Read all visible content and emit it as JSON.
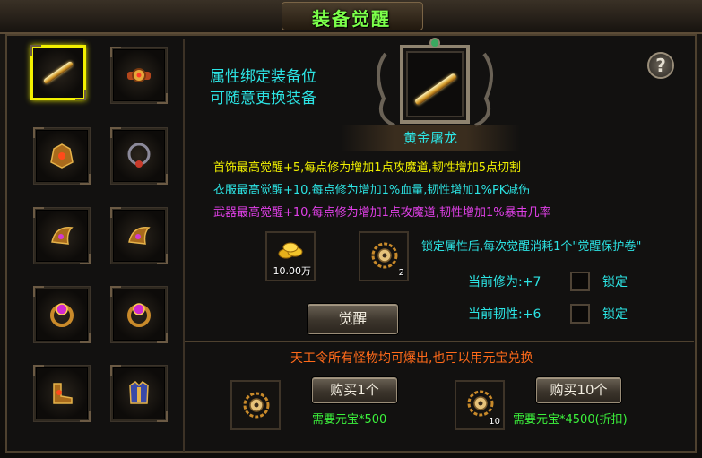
{
  "window": {
    "title": "装备觉醒"
  },
  "intro": {
    "line1": "属性绑定装备位",
    "line2": "可随意更换装备"
  },
  "item": {
    "name": "黄金屠龙"
  },
  "bonuses": {
    "necklace": "首饰最高觉醒+5,每点修为增加1点攻魔道,韧性增加5点切割",
    "clothes": "衣服最高觉醒+10,每点修为增加1%血量,韧性增加1%PK减伤",
    "weapon": "武器最高觉醒+10,每点修为增加1点攻魔道,韧性增加1%暴击几率"
  },
  "colors": {
    "necklace": "#f0f000",
    "clothes": "#2ce4e4",
    "weapon": "#e040e8",
    "notice": "#ff6a1a",
    "cost": "#3cf23c"
  },
  "cost": {
    "gold": "10.00万",
    "scroll_count": "2",
    "lock_notice": "锁定属性后,每次觉醒消耗1个\"觉醒保护卷\""
  },
  "stats": {
    "cultivation": "当前修为:+7",
    "toughness": "当前韧性:+6",
    "lock_label_1": "锁定",
    "lock_label_2": "锁定"
  },
  "actions": {
    "awaken": "觉醒"
  },
  "shop": {
    "notice": "天工令所有怪物均可爆出,也可以用元宝兑换",
    "buy1_label": "购买1个",
    "buy1_cost": "需要元宝*500",
    "buy10_label": "购买10个",
    "buy10_cost": "需要元宝*4500(折扣)",
    "buy10_count": "10"
  },
  "help": {
    "label": "?"
  },
  "icons": {
    "slots": [
      "sword-icon",
      "belt-icon",
      "helmet-icon",
      "necklace-icon",
      "bracelet-icon",
      "bracelet-icon",
      "ring-icon",
      "ring-icon",
      "boots-icon",
      "armor-icon"
    ],
    "currency": "gold-coins-icon",
    "scroll": "awakening-token-icon"
  }
}
